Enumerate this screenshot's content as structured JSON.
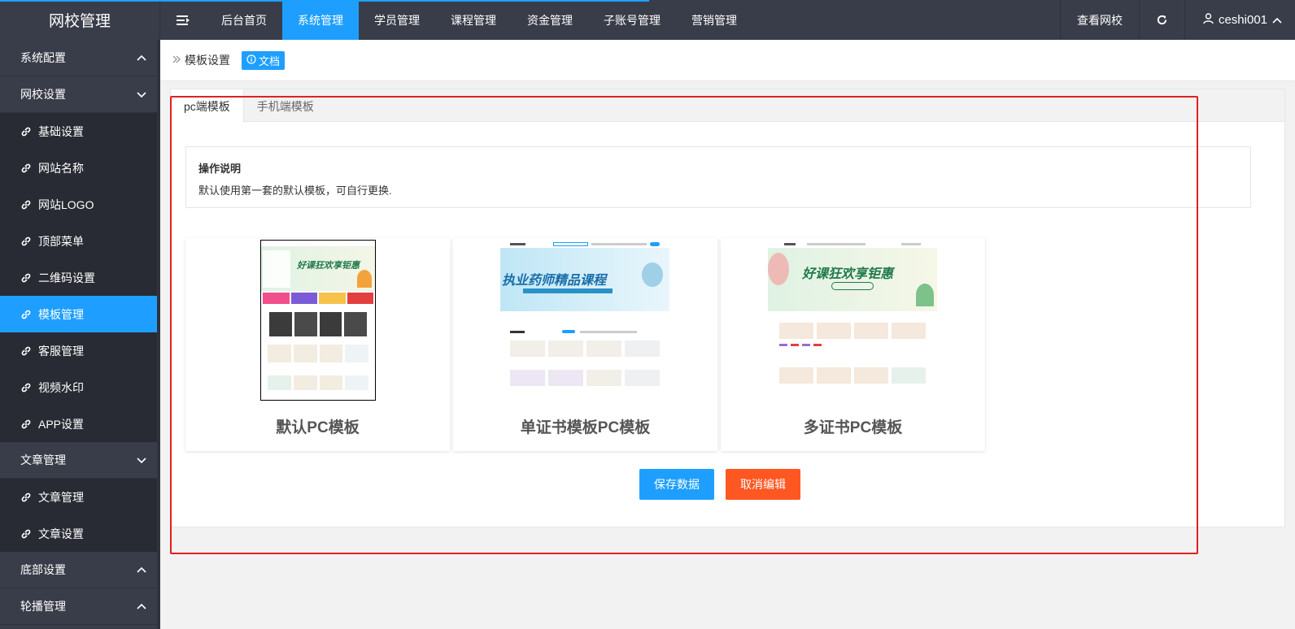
{
  "logo": "网校管理",
  "nav": [
    {
      "label": "后台首页",
      "active": false
    },
    {
      "label": "系统管理",
      "active": true
    },
    {
      "label": "学员管理",
      "active": false
    },
    {
      "label": "课程管理",
      "active": false
    },
    {
      "label": "资金管理",
      "active": false
    },
    {
      "label": "子账号管理",
      "active": false
    },
    {
      "label": "营销管理",
      "active": false
    }
  ],
  "top_right": {
    "view_site": "查看网校",
    "username": "ceshi001"
  },
  "sidebar": {
    "groups": [
      {
        "label": "系统配置",
        "expanded": false
      },
      {
        "label": "网校设置",
        "expanded": true,
        "items": [
          {
            "label": "基础设置"
          },
          {
            "label": "网站名称"
          },
          {
            "label": "网站LOGO"
          },
          {
            "label": "顶部菜单"
          },
          {
            "label": "二维码设置"
          },
          {
            "label": "模板管理",
            "active": true
          },
          {
            "label": "客服管理"
          },
          {
            "label": "视频水印"
          },
          {
            "label": "APP设置"
          }
        ]
      },
      {
        "label": "文章管理",
        "expanded": true,
        "items": [
          {
            "label": "文章管理"
          },
          {
            "label": "文章设置"
          }
        ]
      },
      {
        "label": "底部设置",
        "expanded": false
      },
      {
        "label": "轮播管理",
        "expanded": false
      }
    ]
  },
  "breadcrumb": {
    "current": "模板设置",
    "doc_badge": "文档"
  },
  "tabs": [
    {
      "label": "pc端模板",
      "active": true
    },
    {
      "label": "手机端模板",
      "active": false
    }
  ],
  "notice": {
    "title": "操作说明",
    "desc": "默认使用第一套的默认模板，可自行更换."
  },
  "templates": [
    {
      "name": "默认PC模板",
      "banner": "好课狂欢享钜惠",
      "selected": true
    },
    {
      "name": "单证书模板PC模板",
      "banner": "执业药师精品课程"
    },
    {
      "name": "多证书PC模板",
      "banner": "好课狂欢享钜惠"
    }
  ],
  "buttons": {
    "save": "保存数据",
    "cancel": "取消编辑"
  },
  "colors": {
    "accent": "#1e9fff",
    "danger": "#ff5722",
    "sidebar": "#393d49",
    "sidebar_sub": "#282b33"
  }
}
